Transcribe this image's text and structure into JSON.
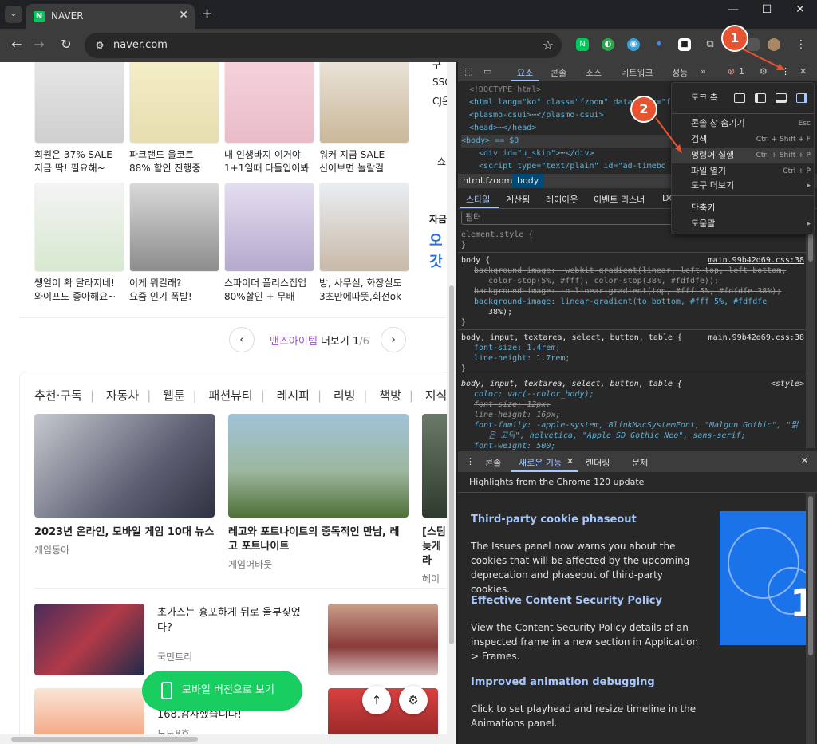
{
  "browser": {
    "tab_title": "NAVER",
    "favicon": "N",
    "url": "naver.com",
    "colors": {
      "naver_green": "#03c75a",
      "devtools_accent": "#a8c7fa",
      "annotation": "#e8542f"
    }
  },
  "page": {
    "products_row1": [
      {
        "caption1": "회원은 37% SALE",
        "caption2": "지금 딱! 필요해~"
      },
      {
        "caption1": "파크랜드 울코트",
        "caption2": "88% 할인 진행중"
      },
      {
        "caption1": "내 인생바지 이거야",
        "caption2": "1+1일때 다들입어봐"
      },
      {
        "caption1": "워커 지금 SALE",
        "caption2": "신어보면 놀랄걸"
      }
    ],
    "products_row2": [
      {
        "caption1": "쌩얼이 확 달라지네!",
        "caption2": "와이프도 좋아해요~"
      },
      {
        "caption1": "이게 뭐길래?",
        "caption2": "요즘 인기 폭발!"
      },
      {
        "caption1": "스파이더 플리스집업",
        "caption2": "80%할인 + 무배"
      },
      {
        "caption1": "방, 사무실, 화장실도",
        "caption2": "3초만에따뜻,회전ok"
      }
    ],
    "right_cut": [
      "구",
      "SSC",
      "CJ온",
      "쇼",
      "자금",
      "오",
      "갓"
    ],
    "pager": {
      "prev": "‹",
      "label_highlight": "맨즈아이템",
      "label_rest": " 더보기 ",
      "current": "1",
      "total": "/6",
      "next": "›"
    },
    "categories": [
      "추천·구독",
      "자동차",
      "웹툰",
      "패션뷰티",
      "레시피",
      "리빙",
      "책방",
      "지식+"
    ],
    "news": [
      {
        "title": "2023년 온라인, 모바일 게임 10대 뉴스",
        "source": "게임동아"
      },
      {
        "title": "레고와 포트나이트의 중독적인 만남, 레고 포트나이트",
        "source": "게임어바웃"
      },
      {
        "title": "[스팀 늦게라",
        "source": "헤이"
      }
    ],
    "list_items": [
      {
        "title": "초가스는 흉포하게 뒤로 울부짖었다?",
        "source": "국민트리"
      },
      {
        "title": "168.감사했습니다!",
        "source": "노도8호"
      }
    ],
    "mobile_button": "모바일 버전으로 보기"
  },
  "devtools": {
    "tabs": [
      "요소",
      "콘솔",
      "소스",
      "네트워크",
      "성능",
      "»"
    ],
    "error_count": "1",
    "elements": [
      "<!DOCTYPE html>",
      "<html lang=\"ko\" class=\"fzoom\" data-dark=\"fa",
      "<plasmo-csui>⋯</plasmo-csui>",
      "<head>⋯</head>",
      "<body> == $0",
      "<div id=\"u_skip\">⋯</div>",
      "<script type=\"text/plain\" id=\"ad-timebo"
    ],
    "breadcrumbs": [
      "html.fzoom",
      "body"
    ],
    "style_tabs": [
      "스타일",
      "계산됨",
      "레이아웃",
      "이벤트 리스너",
      "DO"
    ],
    "filter_placeholder": "필터",
    "styles": {
      "element_style": "element.style {",
      "rule1_selector": "body {",
      "rule1_src": "main.99b42d69.css:38",
      "rule1_lines": [
        "background-image: -webkit-gradient(linear, left top, left bottom,",
        "color-stop(5%, #fff), color-stop(38%, #fdfdfe));",
        "background-image: -o-linear-gradient(top, #fff 5%, #fdfdfe 38%);",
        "background-image: linear-gradient(to bottom, #fff 5%, #fdfdfe",
        "38%);"
      ],
      "rule2_selector": "body, input, textarea, select, button, table {",
      "rule2_src": "main.99b42d69.css:38",
      "rule2_lines": [
        "font-size: 1.4rem;",
        "line-height: 1.7rem;"
      ],
      "rule3_selector": "body, input, textarea, select, button, table {",
      "rule3_src": "<style>",
      "rule3_lines": [
        "color: var(--color_body);",
        "font-size: 12px;",
        "line-height: 16px;",
        "font-family: -apple-system, BlinkMacSystemFont, \"Malgun Gothic\", \"맑",
        "은 고딕\", helvetica, \"Apple SD Gothic Neo\", sans-serif;",
        "font-weight: 500;"
      ],
      "close_brace": "}"
    },
    "drawer_tabs": [
      "콘솔",
      "새로운 기능",
      "렌더링",
      "문제"
    ],
    "whats_new_header": "Highlights from the Chrome 120 update",
    "whats_new": [
      {
        "heading": "Third-party cookie phaseout",
        "body": "The Issues panel now warns you about the cookies that will be affected by the upcoming deprecation and phaseout of third-party cookies."
      },
      {
        "heading": "Effective Content Security Policy",
        "body": "View the Content Security Policy details of an inspected frame in a new section in Application > Frames."
      },
      {
        "heading": "Improved animation debugging",
        "body": "Click to set playhead and resize timeline in the Animations panel."
      }
    ],
    "banner_text": "1"
  },
  "menu": {
    "dock_label": "도크 측",
    "items": [
      {
        "label": "콘솔 창 숨기기",
        "key": "Esc"
      },
      {
        "label": "검색",
        "key": "Ctrl + Shift + F"
      },
      {
        "label": "명령어 실행",
        "key": "Ctrl + Shift + P"
      },
      {
        "label": "파일 열기",
        "key": "Ctrl + P"
      },
      {
        "label": "도구 더보기",
        "key": "▸"
      },
      {
        "label": "단축키",
        "key": ""
      },
      {
        "label": "도움말",
        "key": "▸"
      }
    ]
  },
  "annotations": {
    "badge1": "1",
    "badge2": "2"
  }
}
